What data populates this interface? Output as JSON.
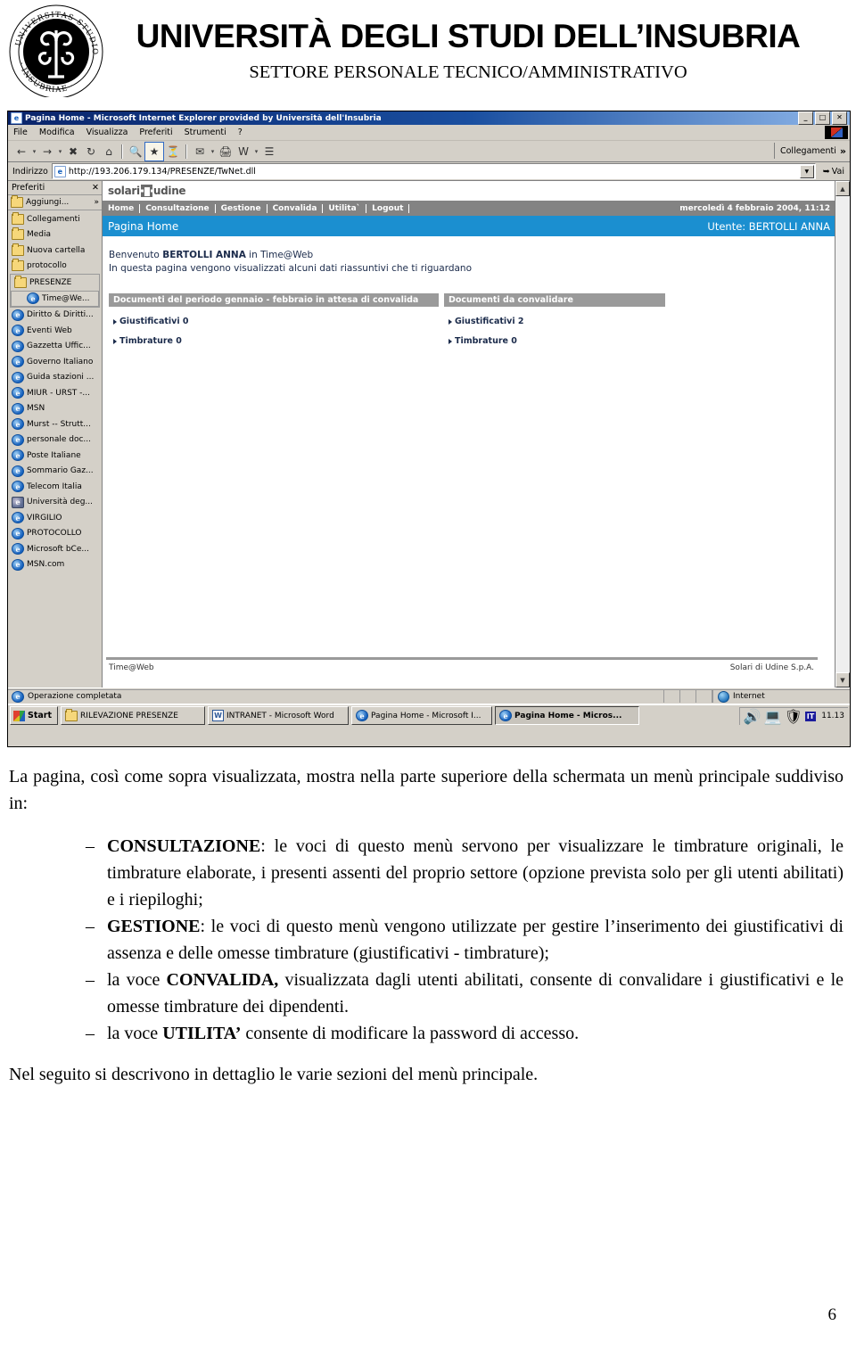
{
  "letterhead": {
    "title": "UNIVERSITÀ DEGLI STUDI DELL’INSUBRIA",
    "subtitle": "SETTORE PERSONALE TECNICO/AMMINISTRATIVO",
    "logo_icon": "university-seal-icon"
  },
  "browser": {
    "window_title": "Pagina Home - Microsoft Internet Explorer provided by Università dell'Insubria",
    "window_icon": "internet-explorer-icon",
    "minimize": "_",
    "maximize": "□",
    "close": "✕",
    "menu": [
      "File",
      "Modifica",
      "Visualizza",
      "Preferiti",
      "Strumenti",
      "?"
    ],
    "toolbar_icons": [
      "back-icon",
      "back-dropdown-icon",
      "forward-icon",
      "forward-dropdown-icon",
      "stop-icon",
      "refresh-icon",
      "home-icon",
      "search-icon",
      "favorites-icon",
      "history-icon",
      "mail-icon",
      "mail-dropdown-icon",
      "print-icon",
      "edit-word-icon",
      "edit-dropdown-icon",
      "discuss-icon"
    ],
    "links_label": "Collegamenti",
    "links_chevron": "»",
    "address_label": "Indirizzo",
    "address_value": "http://193.206.179.134/PRESENZE/TwNet.dll",
    "go_label": "Vai"
  },
  "favorites": {
    "header": "Preferiti",
    "close_icon": "close-icon",
    "add_label": "Aggiungi...",
    "add_chevron": "»",
    "items": [
      {
        "label": "Collegamenti",
        "icon": "folder-icon",
        "type": "folder"
      },
      {
        "label": "Media",
        "icon": "folder-icon",
        "type": "folder"
      },
      {
        "label": "Nuova cartella",
        "icon": "folder-icon",
        "type": "folder"
      },
      {
        "label": "protocollo",
        "icon": "folder-icon",
        "type": "folder"
      },
      {
        "label": "PRESENZE",
        "icon": "folder-open-icon",
        "type": "folder-open"
      },
      {
        "label": "Time@We...",
        "icon": "internet-explorer-icon",
        "type": "link-indent"
      },
      {
        "label": "Diritto & Diritti...",
        "icon": "internet-explorer-icon",
        "type": "link"
      },
      {
        "label": "Eventi Web",
        "icon": "internet-explorer-icon",
        "type": "link"
      },
      {
        "label": "Gazzetta Uffic...",
        "icon": "internet-explorer-icon",
        "type": "link"
      },
      {
        "label": "Governo Italiano",
        "icon": "internet-explorer-icon",
        "type": "link"
      },
      {
        "label": "Guida stazioni ...",
        "icon": "internet-explorer-icon",
        "type": "link"
      },
      {
        "label": "MIUR - URST -...",
        "icon": "internet-explorer-icon",
        "type": "link"
      },
      {
        "label": "MSN",
        "icon": "internet-explorer-icon",
        "type": "link"
      },
      {
        "label": "Murst -- Strutt...",
        "icon": "internet-explorer-icon",
        "type": "link"
      },
      {
        "label": "personale doc...",
        "icon": "internet-explorer-icon",
        "type": "link"
      },
      {
        "label": "Poste Italiane",
        "icon": "internet-explorer-icon",
        "type": "link"
      },
      {
        "label": "Sommario Gaz...",
        "icon": "internet-explorer-icon",
        "type": "link"
      },
      {
        "label": "Telecom Italia",
        "icon": "internet-explorer-icon",
        "type": "link"
      },
      {
        "label": "Università deg...",
        "icon": "shortcut-icon",
        "type": "link-alt"
      },
      {
        "label": "VIRGILIO",
        "icon": "internet-explorer-icon",
        "type": "link"
      },
      {
        "label": "PROTOCOLLO",
        "icon": "internet-explorer-icon",
        "type": "link"
      },
      {
        "label": "Microsoft bCe...",
        "icon": "internet-explorer-icon",
        "type": "link"
      },
      {
        "label": "MSN.com",
        "icon": "internet-explorer-icon",
        "type": "link"
      }
    ]
  },
  "webpage": {
    "brand": "solari",
    "brand2": "udine",
    "nav_items": [
      "Home",
      "Consultazione",
      "Gestione",
      "Convalida",
      "Utilita`",
      "Logout"
    ],
    "datetime": "mercoledì 4 febbraio 2004, 11:12",
    "page_title": "Pagina Home",
    "user_label": "Utente: BERTOLLI ANNA",
    "welcome_pre": "Benvenuto ",
    "welcome_name": "BERTOLLI ANNA",
    "welcome_post": " in Time@Web",
    "welcome_line2": "In questa pagina vengono visualizzati alcuni dati riassuntivi che ti riguardano",
    "panels": [
      {
        "title": "Documenti del periodo gennaio - febbraio in attesa di convalida",
        "rows": [
          {
            "label": "Giustificativi 0"
          },
          {
            "label": "Timbrature 0"
          }
        ]
      },
      {
        "title": "Documenti da convalidare",
        "rows": [
          {
            "label": "Giustificativi 2"
          },
          {
            "label": "Timbrature 0"
          }
        ]
      }
    ],
    "footer_left": "Time@Web",
    "footer_right": "Solari di Udine S.p.A.",
    "scroll_up_icon": "scroll-up-arrow-icon",
    "scroll_down_icon": "scroll-down-arrow-icon"
  },
  "statusbar": {
    "text": "Operazione completata",
    "icon": "internet-explorer-icon",
    "zone": "Internet",
    "zone_icon": "globe-icon"
  },
  "taskbar": {
    "start_label": "Start",
    "start_icon": "windows-flag-icon",
    "buttons": [
      {
        "label": "RILEVAZIONE PRESENZE",
        "icon": "folder-icon",
        "active": false
      },
      {
        "label": "INTRANET - Microsoft Word",
        "icon": "word-icon",
        "active": false
      },
      {
        "label": "Pagina Home - Microsoft I...",
        "icon": "internet-explorer-icon",
        "active": false
      },
      {
        "label": "Pagina Home - Micros...",
        "icon": "internet-explorer-icon",
        "active": true
      }
    ],
    "tray_icons": [
      "volume-icon",
      "network-icon",
      "shield-icon"
    ],
    "language": "IT",
    "clock": "11.13"
  },
  "document": {
    "intro": "La  pagina, così come sopra visualizzata, mostra nella parte superiore della schermata un menù principale suddiviso in:",
    "bullets": [
      {
        "bold": "CONSULTAZIONE",
        "bold_suffix": ":",
        "text": " le voci di questo menù servono per visualizzare le timbrature originali, le timbrature elaborate, i presenti assenti del proprio settore (opzione prevista solo per gli utenti abilitati) e i riepiloghi;"
      },
      {
        "bold": "GESTIONE",
        "bold_suffix": ":",
        "text": " le voci di questo menù vengono utilizzate per gestire l’inserimento dei giustificativi di assenza e delle omesse timbrature (giustificativi - timbrature);"
      },
      {
        "prefix": "la voce ",
        "bold": "CONVALIDA,",
        "bold_suffix": "",
        "text": " visualizzata dagli utenti abilitati, consente di convalidare i giustificativi e le omesse timbrature dei dipendenti."
      },
      {
        "prefix": "la voce ",
        "bold": "UTILITA’",
        "bold_suffix": "",
        "text": " consente di modificare la password di accesso."
      }
    ],
    "closing": "Nel seguito si descrivono in dettaglio le varie sezioni del menù principale.",
    "page_number": "6"
  }
}
